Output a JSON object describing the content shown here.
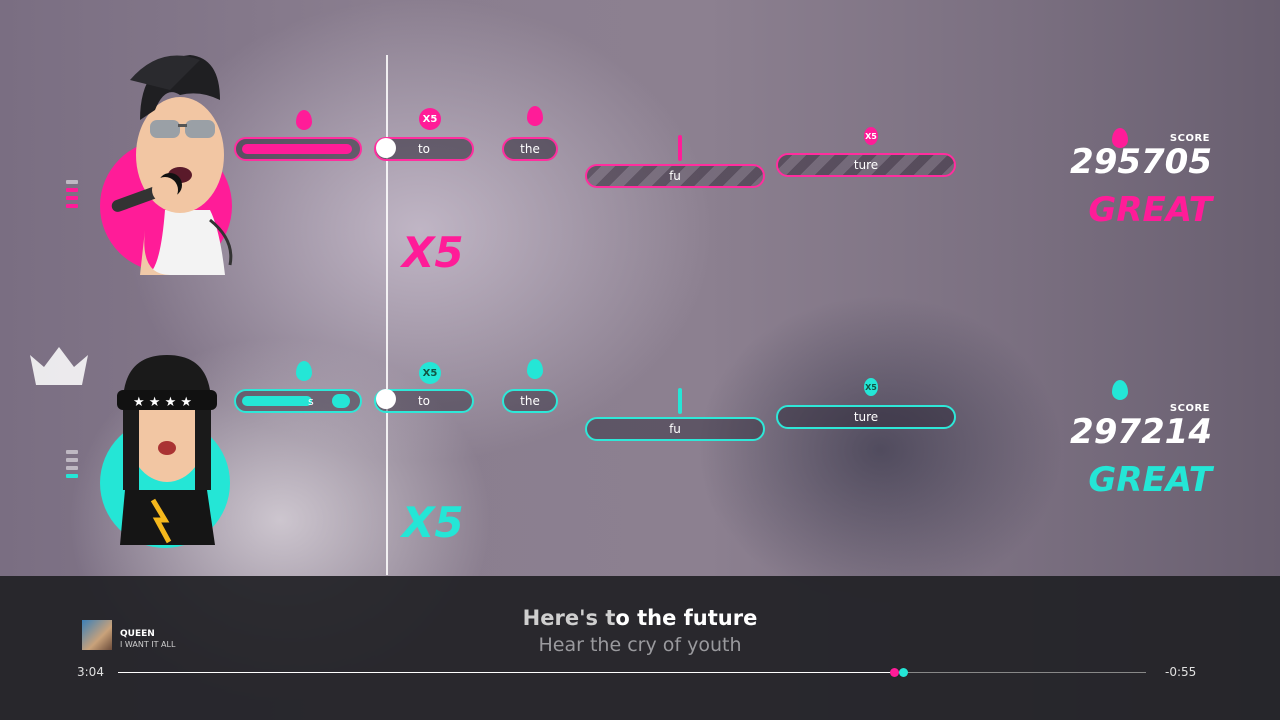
{
  "colors": {
    "player1": "#ff1c98",
    "player2": "#24e6d6",
    "panel": "#222226"
  },
  "player1": {
    "notes": [
      "to",
      "the",
      "fu",
      "ture"
    ],
    "bubble_top": "X5",
    "bubble_small": "X5",
    "multiplier": "X5",
    "score_label": "SCORE",
    "score": "295705",
    "rating": "GREAT"
  },
  "player2": {
    "notes": [
      "s",
      "to",
      "the",
      "fu",
      "ture"
    ],
    "bubble_top": "X5",
    "bubble_small": "X5",
    "multiplier": "X5",
    "score_label": "SCORE",
    "score": "297214",
    "rating": "GREAT"
  },
  "leader_icon": "crown-icon",
  "song": {
    "artist": "QUEEN",
    "title": "I WANT IT ALL"
  },
  "lyrics": {
    "current_sung": "Here's t",
    "current_rest": "o the future",
    "next": "Hear the cry of youth"
  },
  "progress": {
    "elapsed": "3:04",
    "remaining": "-0:55",
    "fraction": 0.755
  }
}
